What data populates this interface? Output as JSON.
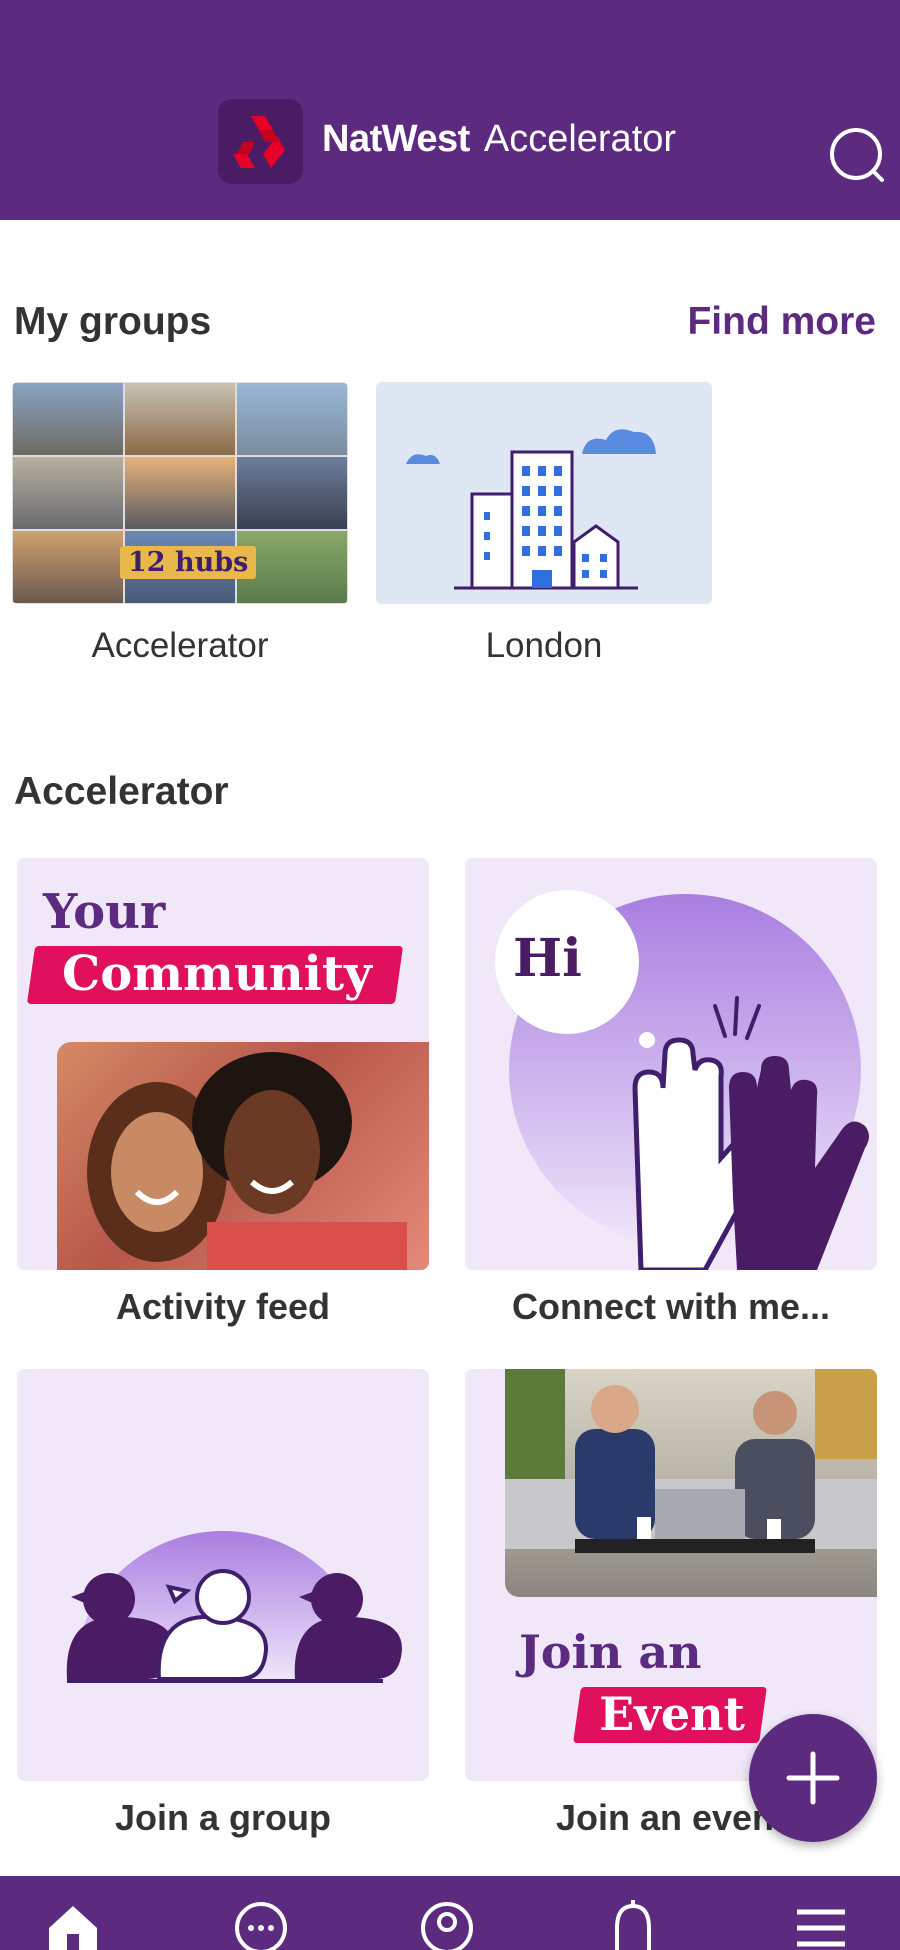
{
  "header": {
    "brand_name": "NatWest",
    "brand_product": "Accelerator",
    "logo_icon": "natwest-logo-icon",
    "search_icon": "search-icon",
    "background_color": "#5c2a7e"
  },
  "my_groups": {
    "title": "My groups",
    "find_more_label": "Find more",
    "items": [
      {
        "label": "Accelerator",
        "badge": "12 hubs"
      },
      {
        "label": "London"
      }
    ]
  },
  "accelerator": {
    "title": "Accelerator",
    "tiles": [
      {
        "label": "Activity feed",
        "art_line1": "Your",
        "art_line2": "Community"
      },
      {
        "label": "Connect with me...",
        "art_text": "Hi"
      },
      {
        "label": "Join a group"
      },
      {
        "label": "Join an event",
        "art_line1": "Join an",
        "art_line2": "Event"
      }
    ]
  },
  "fab": {
    "icon": "plus-icon"
  },
  "bottom_nav": {
    "items": [
      "home-icon",
      "chat-icon",
      "profile-icon",
      "bell-icon",
      "menu-icon"
    ]
  },
  "colors": {
    "brand_purple": "#5c2a7e",
    "accent_pink": "#e0105c",
    "tile_background": "#f0e8f8"
  }
}
